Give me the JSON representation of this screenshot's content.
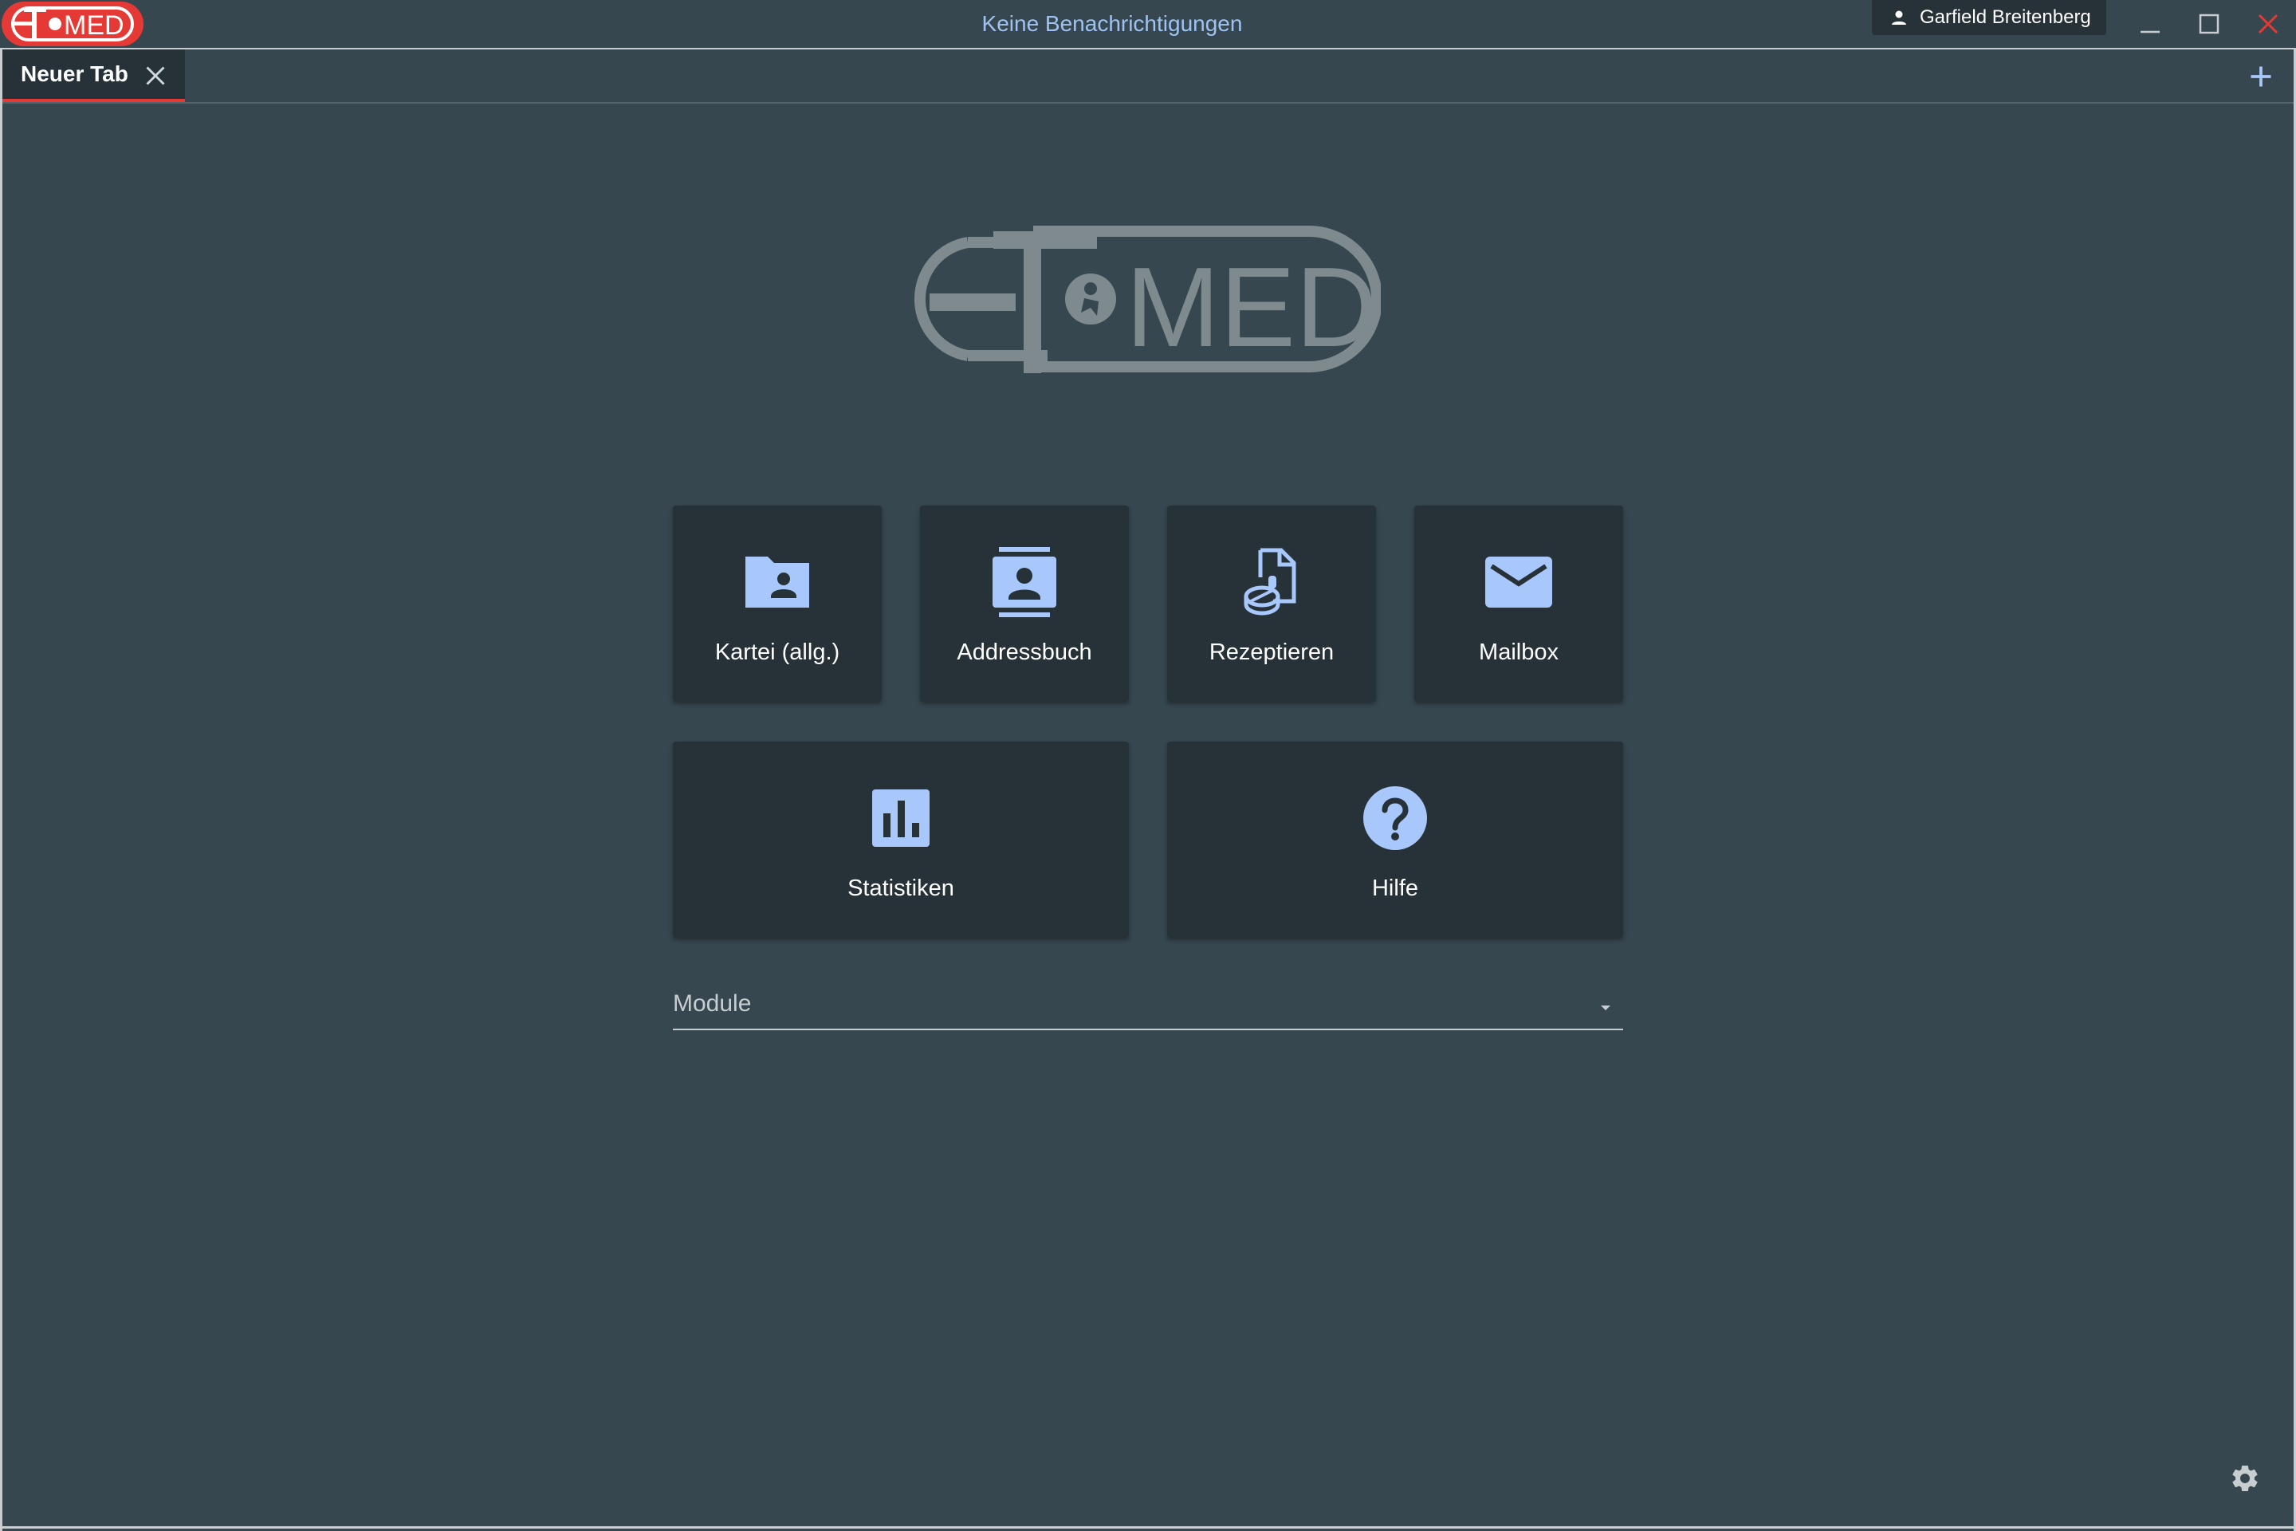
{
  "window": {
    "logo_text": "ET MED",
    "notifications": "Keine Benachrichtigungen",
    "user_name": "Garfield Breitenberg",
    "icons": [
      "person-icon",
      "minimize-icon",
      "maximize-icon",
      "close-icon"
    ]
  },
  "tabs": {
    "items": [
      {
        "label": "Neuer Tab",
        "active": true
      }
    ],
    "add_icon": "plus-icon"
  },
  "main": {
    "logo_text": "ET MED",
    "tiles": [
      {
        "label": "Kartei (allg.)",
        "icon": "folder-person-icon"
      },
      {
        "label": "Addressbuch",
        "icon": "contact-card-icon"
      },
      {
        "label": "Rezeptieren",
        "icon": "prescription-pill-icon"
      },
      {
        "label": "Mailbox",
        "icon": "mail-icon"
      },
      {
        "label": "Statistiken",
        "icon": "bar-chart-icon"
      },
      {
        "label": "Hilfe",
        "icon": "help-circle-icon"
      }
    ],
    "module_select": {
      "label": "Module",
      "value": ""
    }
  },
  "colors": {
    "background": "#37474f",
    "tile": "#263238",
    "accent_icon": "#a8c7fa",
    "tab_indicator": "#e53935",
    "brand_red": "#e53935",
    "notification_text": "#9ec3f2",
    "logo_gray": "#7f8a8f"
  }
}
